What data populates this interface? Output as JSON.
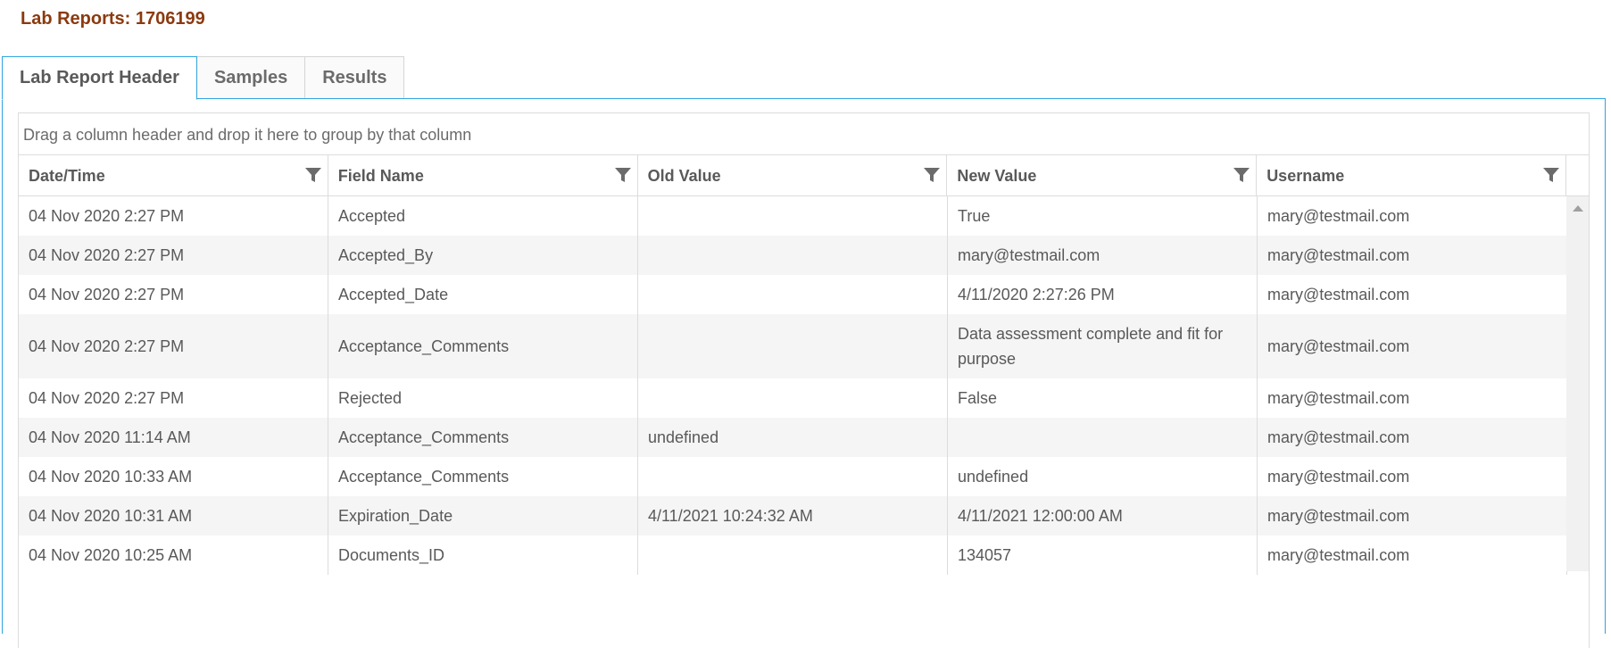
{
  "page": {
    "title": "Lab Reports: 1706199"
  },
  "tabs": [
    {
      "label": "Lab Report Header",
      "active": true
    },
    {
      "label": "Samples",
      "active": false
    },
    {
      "label": "Results",
      "active": false
    }
  ],
  "grid": {
    "group_hint": "Drag a column header and drop it here to group by that column",
    "columns": [
      "Date/Time",
      "Field Name",
      "Old Value",
      "New Value",
      "Username"
    ],
    "rows": [
      [
        "04 Nov 2020 2:27 PM",
        "Accepted",
        "",
        "True",
        "mary@testmail.com"
      ],
      [
        "04 Nov 2020 2:27 PM",
        "Accepted_By",
        "",
        "mary@testmail.com",
        "mary@testmail.com"
      ],
      [
        "04 Nov 2020 2:27 PM",
        "Accepted_Date",
        "",
        "4/11/2020 2:27:26 PM",
        "mary@testmail.com"
      ],
      [
        "04 Nov 2020 2:27 PM",
        "Acceptance_Comments",
        "",
        "Data assessment complete and fit for purpose",
        "mary@testmail.com"
      ],
      [
        "04 Nov 2020 2:27 PM",
        "Rejected",
        "",
        "False",
        "mary@testmail.com"
      ],
      [
        "04 Nov 2020 11:14 AM",
        "Acceptance_Comments",
        "undefined",
        "",
        "mary@testmail.com"
      ],
      [
        "04 Nov 2020 10:33 AM",
        "Acceptance_Comments",
        "",
        "undefined",
        "mary@testmail.com"
      ],
      [
        "04 Nov 2020 10:31 AM",
        "Expiration_Date",
        "4/11/2021 10:24:32 AM",
        "4/11/2021 12:00:00 AM",
        "mary@testmail.com"
      ],
      [
        "04 Nov 2020 10:25 AM",
        "Documents_ID",
        "",
        "134057",
        "mary@testmail.com"
      ]
    ]
  },
  "icons": {
    "filter": "filter-icon",
    "scroll_up": "arrow-up-icon"
  },
  "colors": {
    "title": "#8b3a0f",
    "accent": "#2fa4e0",
    "alt_row": "#f5f5f5"
  }
}
